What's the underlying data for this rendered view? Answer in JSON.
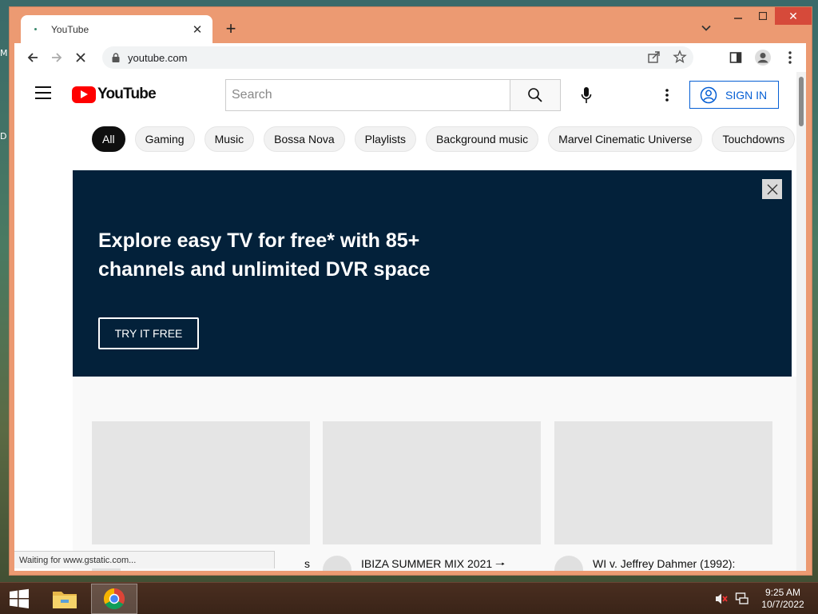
{
  "desktop": {
    "letters": [
      "M",
      "D"
    ]
  },
  "browser": {
    "tab": {
      "title": "YouTube",
      "favicon": "loading-dot-icon",
      "close_icon": "close-icon"
    },
    "new_tab_icon": "plus-icon",
    "window_controls": [
      "minimize-icon",
      "maximize-icon",
      "close-icon"
    ],
    "url": "youtube.com",
    "status_text": "Waiting for www.gstatic.com..."
  },
  "youtube": {
    "logo_text": "YouTube",
    "search": {
      "placeholder": "Search",
      "value": ""
    },
    "sign_in_label": "SIGN IN",
    "chips": [
      {
        "label": "All",
        "active": true
      },
      {
        "label": "Gaming"
      },
      {
        "label": "Music"
      },
      {
        "label": "Bossa Nova"
      },
      {
        "label": "Playlists"
      },
      {
        "label": "Background music"
      },
      {
        "label": "Marvel Cinematic Universe"
      },
      {
        "label": "Touchdowns"
      }
    ],
    "banner": {
      "headline_line1": "Explore easy TV for free* with 85+",
      "headline_line2": "channels and unlimited DVR space",
      "cta": "TRY IT FREE",
      "background": "#03213a"
    },
    "videos": [
      {
        "title": "s"
      },
      {
        "title": "IBIZA SUMMER MIX 2021 🠒"
      },
      {
        "title": "WI v. Jeffrey Dahmer (1992):"
      }
    ]
  },
  "taskbar": {
    "apps": [
      "file-explorer-icon",
      "chrome-icon"
    ],
    "time": "9:25 AM",
    "date": "10/7/2022"
  },
  "colors": {
    "window_frame": "#ec9a72",
    "youtube_red": "#ff0000",
    "link_blue": "#065fd4"
  }
}
